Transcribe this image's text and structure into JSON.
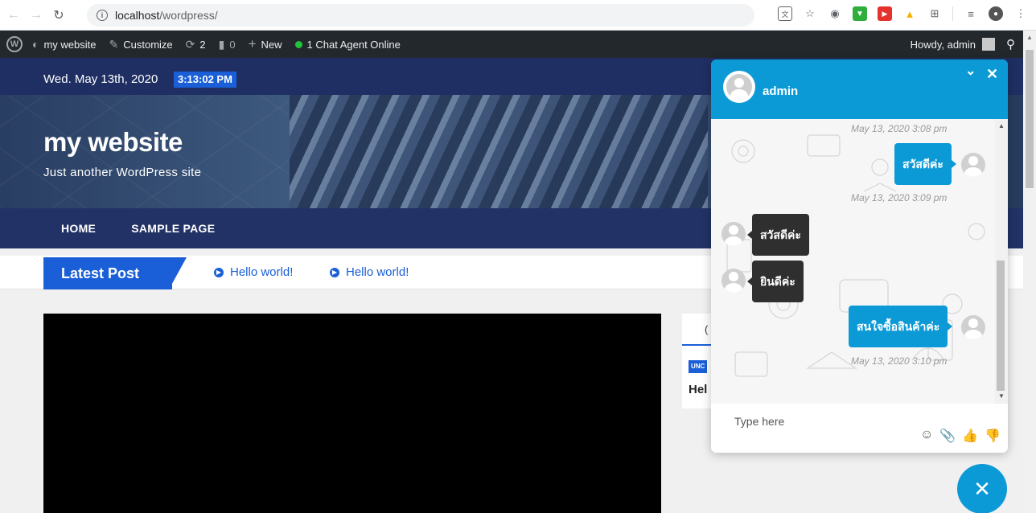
{
  "browser": {
    "url_host": "localhost",
    "url_path": "/wordpress/",
    "back_icon": "arrow-left-icon",
    "forward_icon": "arrow-right-icon",
    "reload_icon": "reload-icon",
    "extension_icons": [
      "translate-icon",
      "star-icon",
      "camera-icon",
      "ext-green-icon",
      "ext-red-play-icon",
      "thumbs-up-ext-icon",
      "grid-icon",
      "menu-list-icon",
      "profile-icon",
      "kebab-menu-icon"
    ]
  },
  "admin_bar": {
    "site_name": "my website",
    "customize": "Customize",
    "updates_count": "2",
    "comments_count": "0",
    "new_label": "New",
    "chat_status": "1 Chat Agent Online",
    "howdy": "Howdy, admin",
    "status_color": "#21c43a"
  },
  "site": {
    "date": "Wed. May 13th, 2020",
    "time": "3:13:02 PM",
    "title": "my website",
    "tagline": "Just another WordPress site",
    "nav": [
      "HOME",
      "SAMPLE PAGE"
    ],
    "accent_color": "#1a5fd8"
  },
  "ticker": {
    "label": "Latest Post",
    "items": [
      "Hello world!",
      "Hello world!"
    ]
  },
  "sidebar": {
    "tab_letter": "(",
    "badge": "UNC",
    "post_title": "Hel"
  },
  "chat": {
    "agent_name": "admin",
    "brand_color": "#0c9ad7",
    "messages": [
      {
        "type": "time",
        "text": "May 13, 2020 3:08 pm"
      },
      {
        "type": "out",
        "text": "สวัสดีค่ะ"
      },
      {
        "type": "time",
        "text": "May 13, 2020 3:09 pm"
      },
      {
        "type": "in",
        "text": "สวัสดีค่ะ"
      },
      {
        "type": "in",
        "text": "ยินดีค่ะ"
      },
      {
        "type": "out",
        "text": "สนใจซื้อสินค้าค่ะ"
      },
      {
        "type": "time",
        "text": "May 13, 2020 3:10 pm"
      }
    ],
    "input_placeholder": "Type here",
    "footer_icons": [
      "smiley-icon",
      "paperclip-icon",
      "thumbs-up-icon",
      "thumbs-down-icon"
    ]
  }
}
